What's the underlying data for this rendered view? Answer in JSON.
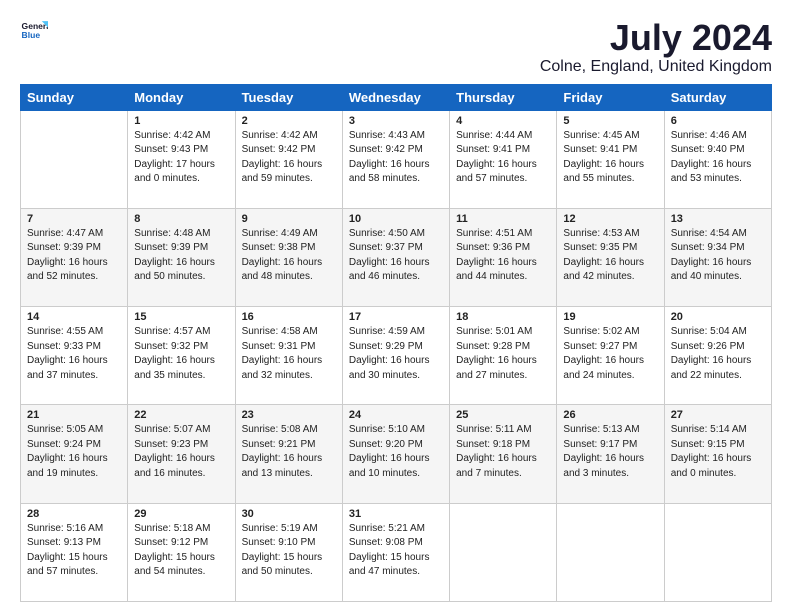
{
  "logo": {
    "general": "General",
    "blue": "Blue"
  },
  "title": "July 2024",
  "subtitle": "Colne, England, United Kingdom",
  "headers": [
    "Sunday",
    "Monday",
    "Tuesday",
    "Wednesday",
    "Thursday",
    "Friday",
    "Saturday"
  ],
  "weeks": [
    [
      {
        "day": "",
        "content": ""
      },
      {
        "day": "1",
        "content": "Sunrise: 4:42 AM\nSunset: 9:43 PM\nDaylight: 17 hours\nand 0 minutes."
      },
      {
        "day": "2",
        "content": "Sunrise: 4:42 AM\nSunset: 9:42 PM\nDaylight: 16 hours\nand 59 minutes."
      },
      {
        "day": "3",
        "content": "Sunrise: 4:43 AM\nSunset: 9:42 PM\nDaylight: 16 hours\nand 58 minutes."
      },
      {
        "day": "4",
        "content": "Sunrise: 4:44 AM\nSunset: 9:41 PM\nDaylight: 16 hours\nand 57 minutes."
      },
      {
        "day": "5",
        "content": "Sunrise: 4:45 AM\nSunset: 9:41 PM\nDaylight: 16 hours\nand 55 minutes."
      },
      {
        "day": "6",
        "content": "Sunrise: 4:46 AM\nSunset: 9:40 PM\nDaylight: 16 hours\nand 53 minutes."
      }
    ],
    [
      {
        "day": "7",
        "content": "Sunrise: 4:47 AM\nSunset: 9:39 PM\nDaylight: 16 hours\nand 52 minutes."
      },
      {
        "day": "8",
        "content": "Sunrise: 4:48 AM\nSunset: 9:39 PM\nDaylight: 16 hours\nand 50 minutes."
      },
      {
        "day": "9",
        "content": "Sunrise: 4:49 AM\nSunset: 9:38 PM\nDaylight: 16 hours\nand 48 minutes."
      },
      {
        "day": "10",
        "content": "Sunrise: 4:50 AM\nSunset: 9:37 PM\nDaylight: 16 hours\nand 46 minutes."
      },
      {
        "day": "11",
        "content": "Sunrise: 4:51 AM\nSunset: 9:36 PM\nDaylight: 16 hours\nand 44 minutes."
      },
      {
        "day": "12",
        "content": "Sunrise: 4:53 AM\nSunset: 9:35 PM\nDaylight: 16 hours\nand 42 minutes."
      },
      {
        "day": "13",
        "content": "Sunrise: 4:54 AM\nSunset: 9:34 PM\nDaylight: 16 hours\nand 40 minutes."
      }
    ],
    [
      {
        "day": "14",
        "content": "Sunrise: 4:55 AM\nSunset: 9:33 PM\nDaylight: 16 hours\nand 37 minutes."
      },
      {
        "day": "15",
        "content": "Sunrise: 4:57 AM\nSunset: 9:32 PM\nDaylight: 16 hours\nand 35 minutes."
      },
      {
        "day": "16",
        "content": "Sunrise: 4:58 AM\nSunset: 9:31 PM\nDaylight: 16 hours\nand 32 minutes."
      },
      {
        "day": "17",
        "content": "Sunrise: 4:59 AM\nSunset: 9:29 PM\nDaylight: 16 hours\nand 30 minutes."
      },
      {
        "day": "18",
        "content": "Sunrise: 5:01 AM\nSunset: 9:28 PM\nDaylight: 16 hours\nand 27 minutes."
      },
      {
        "day": "19",
        "content": "Sunrise: 5:02 AM\nSunset: 9:27 PM\nDaylight: 16 hours\nand 24 minutes."
      },
      {
        "day": "20",
        "content": "Sunrise: 5:04 AM\nSunset: 9:26 PM\nDaylight: 16 hours\nand 22 minutes."
      }
    ],
    [
      {
        "day": "21",
        "content": "Sunrise: 5:05 AM\nSunset: 9:24 PM\nDaylight: 16 hours\nand 19 minutes."
      },
      {
        "day": "22",
        "content": "Sunrise: 5:07 AM\nSunset: 9:23 PM\nDaylight: 16 hours\nand 16 minutes."
      },
      {
        "day": "23",
        "content": "Sunrise: 5:08 AM\nSunset: 9:21 PM\nDaylight: 16 hours\nand 13 minutes."
      },
      {
        "day": "24",
        "content": "Sunrise: 5:10 AM\nSunset: 9:20 PM\nDaylight: 16 hours\nand 10 minutes."
      },
      {
        "day": "25",
        "content": "Sunrise: 5:11 AM\nSunset: 9:18 PM\nDaylight: 16 hours\nand 7 minutes."
      },
      {
        "day": "26",
        "content": "Sunrise: 5:13 AM\nSunset: 9:17 PM\nDaylight: 16 hours\nand 3 minutes."
      },
      {
        "day": "27",
        "content": "Sunrise: 5:14 AM\nSunset: 9:15 PM\nDaylight: 16 hours\nand 0 minutes."
      }
    ],
    [
      {
        "day": "28",
        "content": "Sunrise: 5:16 AM\nSunset: 9:13 PM\nDaylight: 15 hours\nand 57 minutes."
      },
      {
        "day": "29",
        "content": "Sunrise: 5:18 AM\nSunset: 9:12 PM\nDaylight: 15 hours\nand 54 minutes."
      },
      {
        "day": "30",
        "content": "Sunrise: 5:19 AM\nSunset: 9:10 PM\nDaylight: 15 hours\nand 50 minutes."
      },
      {
        "day": "31",
        "content": "Sunrise: 5:21 AM\nSunset: 9:08 PM\nDaylight: 15 hours\nand 47 minutes."
      },
      {
        "day": "",
        "content": ""
      },
      {
        "day": "",
        "content": ""
      },
      {
        "day": "",
        "content": ""
      }
    ]
  ]
}
